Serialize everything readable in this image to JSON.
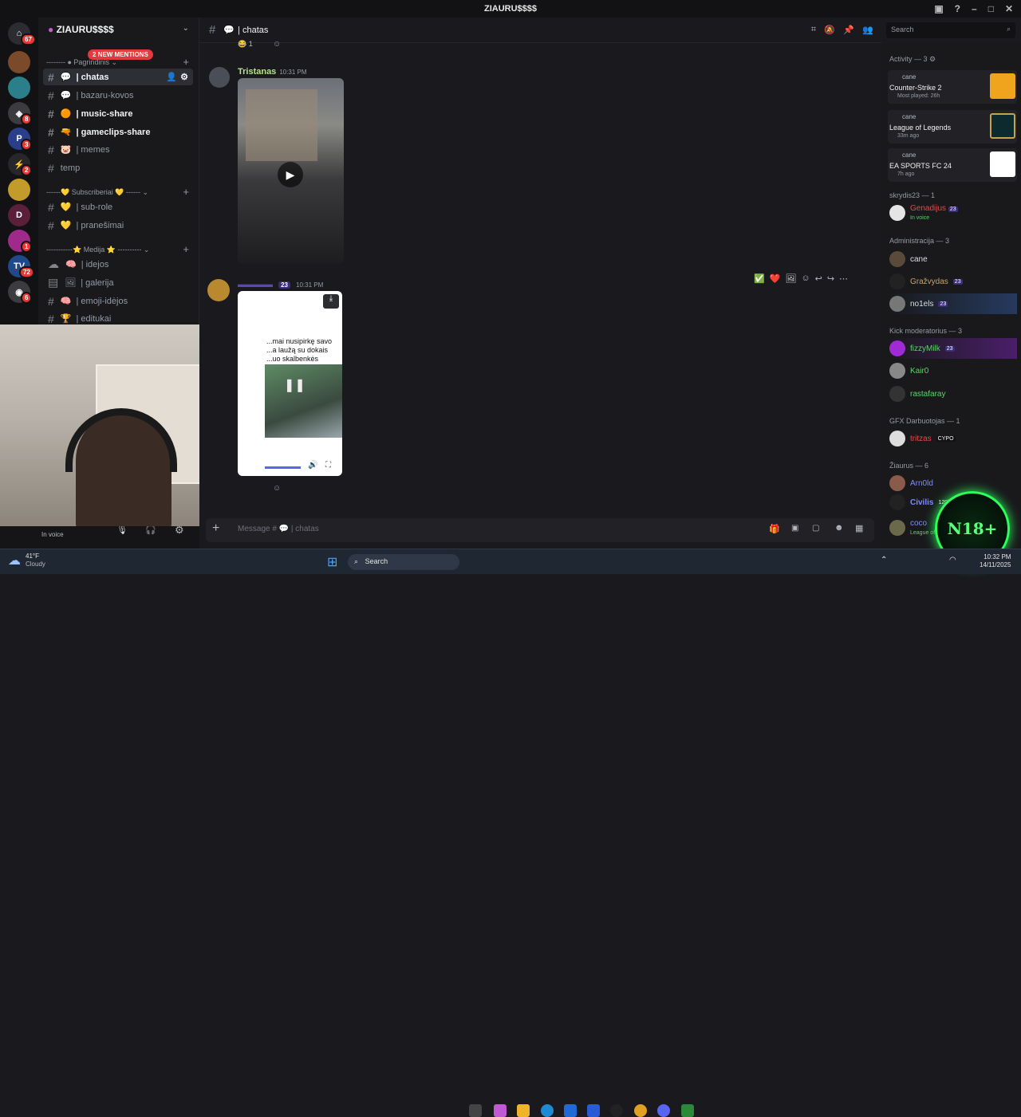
{
  "window": {
    "title": "ZIAURU$$$$"
  },
  "server": {
    "name": "ZIAURU$$$$",
    "mentions_pill": "2 NEW MENTIONS"
  },
  "rail_badges": [
    "67",
    "8",
    "3",
    "2",
    "2",
    "1",
    "72",
    "6"
  ],
  "categories": {
    "main": "Pagrindinis",
    "subs": "Subscriberiai",
    "media": "Medija"
  },
  "channels": [
    {
      "label": "| chatas"
    },
    {
      "label": "| bazaru-kovos"
    },
    {
      "label": "| music-share"
    },
    {
      "label": "| gameclips-share"
    },
    {
      "label": "| memes"
    },
    {
      "label": "temp"
    },
    {
      "label": "| sub-role"
    },
    {
      "label": "| pranešimai"
    },
    {
      "label": "| idejos"
    },
    {
      "label": "| galerija"
    },
    {
      "label": "| emoji-idėjos"
    },
    {
      "label": "| editukai"
    }
  ],
  "header": {
    "channel": "| chatas",
    "search_placeholder": "Search"
  },
  "messages": [
    {
      "author": "Tristanas",
      "time": "10:31 PM"
    },
    {
      "author": "",
      "time": "10:31 PM",
      "boost": "23",
      "caption": "...mai nusipirkę savo ...a laužą su dokais ...uo skalbenkės"
    }
  ],
  "reaction_count": "1",
  "composer": {
    "placeholder": "Message # 💬 | chatas"
  },
  "user": {
    "status": "In voice"
  },
  "members": {
    "activity_title": "Activity — 3",
    "activities": [
      {
        "user": "cane",
        "game": "Counter-Strike 2",
        "detail": "Most played: 26h"
      },
      {
        "user": "cane",
        "game": "League of Legends",
        "detail": "33m ago"
      },
      {
        "user": "cane",
        "game": "EA SPORTS FC 24",
        "detail": "7h ago"
      }
    ],
    "groups": [
      {
        "title": "skrydis23 — 1",
        "members": [
          {
            "name": "Genadijus",
            "sub": "In voice",
            "badge": "23",
            "color": "#e04b4b"
          }
        ]
      },
      {
        "title": "Administracija — 3",
        "members": [
          {
            "name": "cane",
            "color": "#dbdee1"
          },
          {
            "name": "Gražvydas",
            "badge": "23",
            "color": "#c7a46a"
          },
          {
            "name": "no1els",
            "badge": "23",
            "color": "#dbdee1"
          }
        ]
      },
      {
        "title": "Kick moderatorius — 3",
        "members": [
          {
            "name": "fizzyMilk",
            "badge": "23",
            "color": "#5ad46a"
          },
          {
            "name": "Kair0",
            "color": "#5ad46a"
          },
          {
            "name": "rastafaray",
            "color": "#5ad46a"
          }
        ]
      },
      {
        "title": "GFX Darbuotojas — 1",
        "members": [
          {
            "name": "tritzas",
            "badge": "CYPO",
            "color": "#e04b4b"
          }
        ]
      },
      {
        "title": "Žiaurus — 6",
        "members": [
          {
            "name": "Arn0ld",
            "color": "#7b8cff"
          },
          {
            "name": "Civilis",
            "badge": "120kg",
            "color": "#7b8cff"
          },
          {
            "name": "coco",
            "sub": "League of Legends",
            "color": "#7b8cff"
          }
        ]
      }
    ]
  },
  "n18_text": "N18+",
  "taskbar": {
    "temp": "41°F",
    "weather": "Cloudy",
    "search": "Search",
    "time": "10:32 PM",
    "date": "14/11/2025"
  }
}
